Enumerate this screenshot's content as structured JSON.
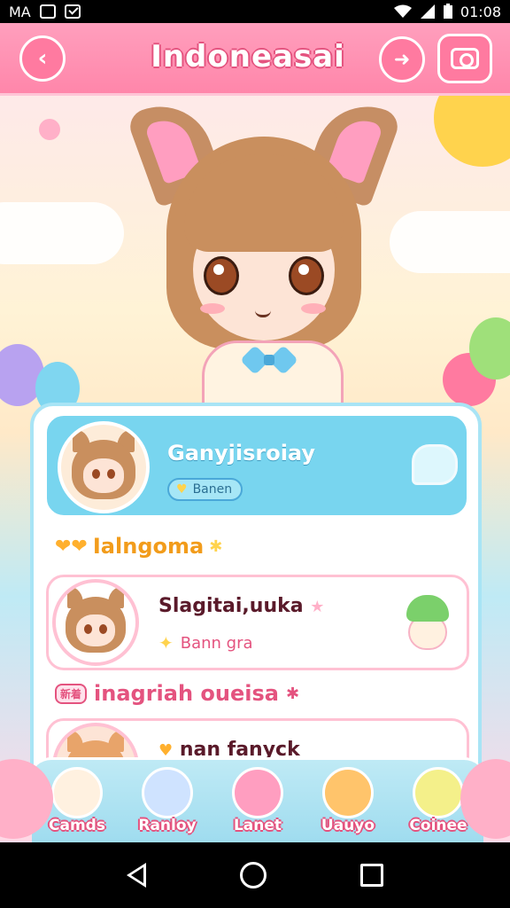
{
  "status_bar": {
    "carrier": "MA",
    "time": "01:08",
    "icons": [
      "notification-box-icon",
      "checkbox-icon",
      "wifi-icon",
      "signal-icon",
      "battery-icon"
    ]
  },
  "header": {
    "title": "Indoneasai",
    "back_icon": "chevron-left-icon",
    "next_icon": "arrow-right-icon",
    "camera_icon": "camera-icon",
    "accent_color": "#ff86aa"
  },
  "profile": {
    "name": "Ganyjisroiay",
    "badge": "Banen",
    "chat_icon": "speech-bubble-icon"
  },
  "sections": [
    {
      "label": "Ialngoma",
      "items": [
        {
          "title": "Slagitai,uuka",
          "subtitle": "Bann gra"
        }
      ]
    },
    {
      "label": "inagriah oueisa",
      "tag": "新着",
      "items": [
        {
          "title": "nan fanyck",
          "subtitle": ""
        }
      ]
    }
  ],
  "bottom_nav": [
    {
      "label": "Camds",
      "icon": "chick-icon"
    },
    {
      "label": "Ranloy",
      "icon": "character-icon"
    },
    {
      "label": "Lanet",
      "icon": "heart-bubble-icon"
    },
    {
      "label": "Uauyo",
      "icon": "cat-icon"
    },
    {
      "label": "Coinee",
      "icon": "bird-icon"
    }
  ],
  "system_nav": [
    "back-icon",
    "home-icon",
    "recents-icon"
  ]
}
